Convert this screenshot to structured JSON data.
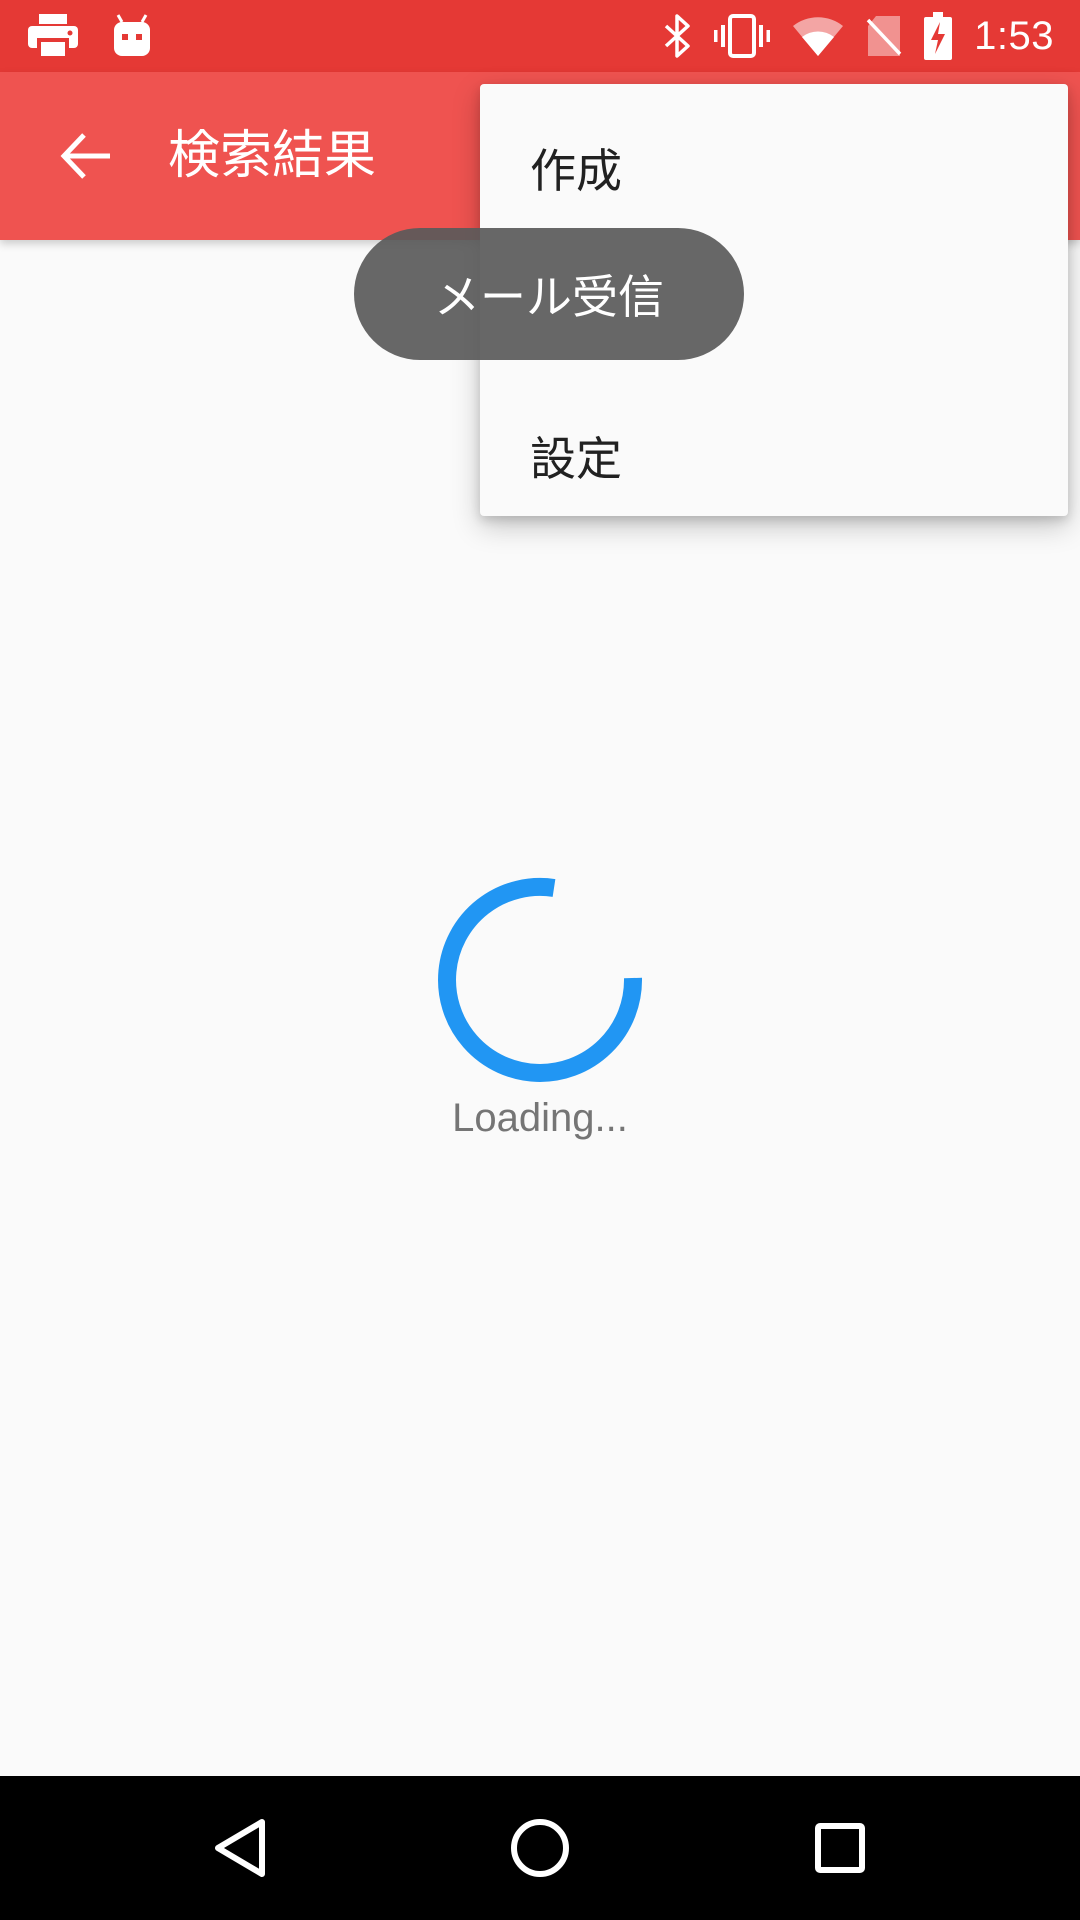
{
  "status_bar": {
    "time": "1:53",
    "left_icons": [
      "printer-icon",
      "android-debug-icon"
    ],
    "right_icons": [
      "bluetooth-icon",
      "vibrate-icon",
      "wifi-icon",
      "no-sim-icon",
      "battery-charging-icon"
    ]
  },
  "app_bar": {
    "title": "検索結果",
    "back_icon": "arrow-back-icon"
  },
  "overflow_menu": {
    "items": [
      {
        "label": "作成"
      },
      {
        "label": ""
      },
      {
        "label": "設定"
      }
    ]
  },
  "toast": {
    "message": "メール受信"
  },
  "loading": {
    "text": "Loading..."
  },
  "nav_bar": {
    "buttons": [
      "back-triangle-icon",
      "home-circle-icon",
      "recents-square-icon"
    ]
  },
  "colors": {
    "status_bar": "#e53935",
    "app_bar": "#ef5350",
    "spinner": "#2196f3",
    "background": "#fafafa"
  }
}
